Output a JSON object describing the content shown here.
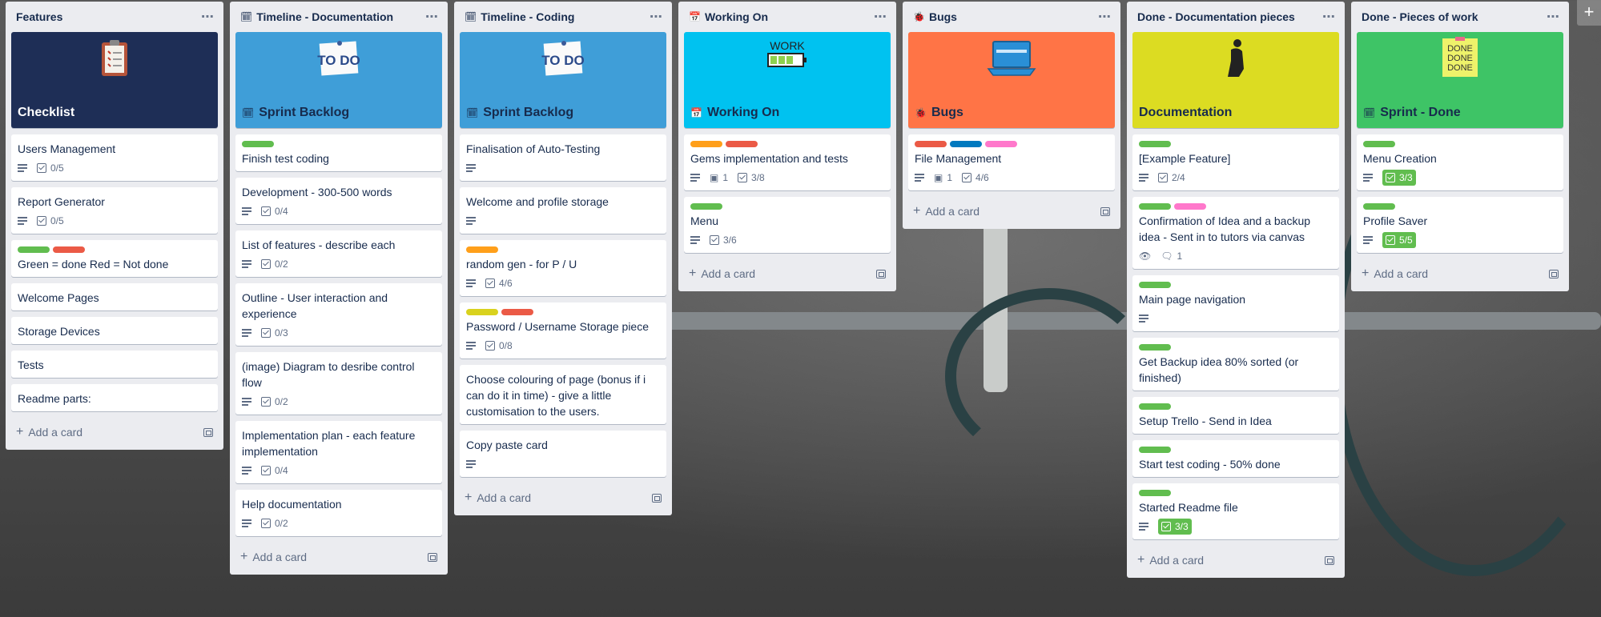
{
  "lists": [
    {
      "title": "Features",
      "icon": "",
      "cover": {
        "color": "#1e2e56",
        "title": "Checklist",
        "title_icon": "",
        "title_color": "#ffffff",
        "art": "clipboard-icon"
      },
      "cards": [
        {
          "title": "Users Management",
          "labels": [],
          "desc": true,
          "check": "0/5"
        },
        {
          "title": "Report Generator",
          "labels": [],
          "desc": true,
          "check": "0/5"
        },
        {
          "title": "Green = done Red = Not done",
          "labels": [
            "#61bd4f",
            "#eb5a46"
          ]
        },
        {
          "title": "Welcome Pages",
          "labels": []
        },
        {
          "title": "Storage Devices",
          "labels": []
        },
        {
          "title": "Tests",
          "labels": []
        },
        {
          "title": "Readme parts:",
          "labels": []
        }
      ],
      "add_label": "Add a card"
    },
    {
      "title": "Timeline - Documentation",
      "icon": "🗓",
      "cover": {
        "color": "#3f9ed8",
        "title": "Sprint Backlog",
        "title_icon": "🗓",
        "title_color": "#172b4d",
        "art": "todo-note-icon",
        "art_text": "TO DO"
      },
      "cards": [
        {
          "title": "Finish test coding",
          "labels": [
            "#61bd4f"
          ]
        },
        {
          "title": "Development - 300-500 words",
          "labels": [],
          "desc": true,
          "check": "0/4"
        },
        {
          "title": "List of features - describe each",
          "labels": [],
          "desc": true,
          "check": "0/2"
        },
        {
          "title": "Outline - User interaction and experience",
          "labels": [],
          "desc": true,
          "check": "0/3"
        },
        {
          "title": "(image) Diagram to desribe control flow",
          "labels": [],
          "desc": true,
          "check": "0/2"
        },
        {
          "title": "Implementation plan - each feature implementation",
          "labels": [],
          "desc": true,
          "check": "0/4"
        },
        {
          "title": "Help documentation",
          "labels": [],
          "desc": true,
          "check": "0/2"
        }
      ],
      "add_label": "Add a card"
    },
    {
      "title": "Timeline - Coding",
      "icon": "🗓",
      "cover": {
        "color": "#3f9ed8",
        "title": "Sprint Backlog",
        "title_icon": "🗓",
        "title_color": "#172b4d",
        "art": "todo-note-icon",
        "art_text": "TO DO"
      },
      "cards": [
        {
          "title": "Finalisation of Auto-Testing",
          "labels": [],
          "desc": true
        },
        {
          "title": "Welcome and profile storage",
          "labels": [],
          "desc": true
        },
        {
          "title": "random gen - for P / U",
          "labels": [
            "#ff9f1a"
          ],
          "desc": true,
          "check": "4/6"
        },
        {
          "title": "Password / Username Storage piece",
          "labels": [
            "#d9d21e",
            "#eb5a46"
          ],
          "desc": true,
          "check": "0/8"
        },
        {
          "title": "Choose colouring of page (bonus if i can do it in time) - give a little customisation to the users.",
          "labels": []
        },
        {
          "title": "Copy paste card",
          "labels": [],
          "desc": true
        }
      ],
      "add_label": "Add a card"
    },
    {
      "title": "Working On",
      "icon": "📅",
      "cover": {
        "color": "#00c2f0",
        "title": "Working On",
        "title_icon": "📅",
        "title_color": "#172b4d",
        "art": "work-battery-icon",
        "art_text": "WORK"
      },
      "cards": [
        {
          "title": "Gems implementation and tests",
          "labels": [
            "#ff9f1a",
            "#eb5a46"
          ],
          "desc": true,
          "attach": "1",
          "check": "3/8"
        },
        {
          "title": "Menu",
          "labels": [
            "#61bd4f"
          ],
          "desc": true,
          "check": "3/6"
        }
      ],
      "add_label": "Add a card"
    },
    {
      "title": "Bugs",
      "icon": "🐞",
      "cover": {
        "color": "#ff7446",
        "title": "Bugs",
        "title_icon": "🐞",
        "title_color": "#172b4d",
        "art": "laptop-icon"
      },
      "cards": [
        {
          "title": "File Management",
          "labels": [
            "#eb5a46",
            "#0079bf",
            "#ff78cb"
          ],
          "desc": true,
          "attach": "1",
          "check": "4/6"
        }
      ],
      "add_label": "Add a card"
    },
    {
      "title": "Done - Documentation pieces",
      "icon": "",
      "cover": {
        "color": "#dcdc22",
        "title": "Documentation",
        "title_icon": "",
        "title_color": "#172b4d",
        "art": "person-icon"
      },
      "cards": [
        {
          "title": "[Example Feature]",
          "labels": [
            "#61bd4f"
          ],
          "desc": true,
          "check": "2/4"
        },
        {
          "title": "Confirmation of Idea and a backup idea - Sent in to tutors via canvas",
          "labels": [
            "#61bd4f",
            "#ff78cb"
          ],
          "watch": true,
          "comments": "1"
        },
        {
          "title": "Main page navigation",
          "labels": [
            "#61bd4f"
          ],
          "desc": true
        },
        {
          "title": "Get Backup idea 80% sorted (or finished)",
          "labels": [
            "#61bd4f"
          ]
        },
        {
          "title": "Setup Trello - Send in Idea",
          "labels": [
            "#61bd4f"
          ]
        },
        {
          "title": "Start test coding - 50% done",
          "labels": [
            "#61bd4f"
          ]
        },
        {
          "title": "Started Readme file",
          "labels": [
            "#61bd4f"
          ],
          "desc": true,
          "check": "3/3",
          "check_done": true
        }
      ],
      "add_label": "Add a card"
    },
    {
      "title": "Done - Pieces of work",
      "icon": "",
      "cover": {
        "color": "#3ec466",
        "title": "Sprint - Done",
        "title_icon": "🗓",
        "title_color": "#172b4d",
        "art": "done-note-icon",
        "art_text": "DONE DONE DONE"
      },
      "cards": [
        {
          "title": "Menu Creation",
          "labels": [
            "#61bd4f"
          ],
          "desc": true,
          "check": "3/3",
          "check_done": true
        },
        {
          "title": "Profile Saver",
          "labels": [
            "#61bd4f"
          ],
          "desc": true,
          "check": "5/5",
          "check_done": true
        }
      ],
      "add_label": "Add a card"
    }
  ],
  "corner_button": "+"
}
